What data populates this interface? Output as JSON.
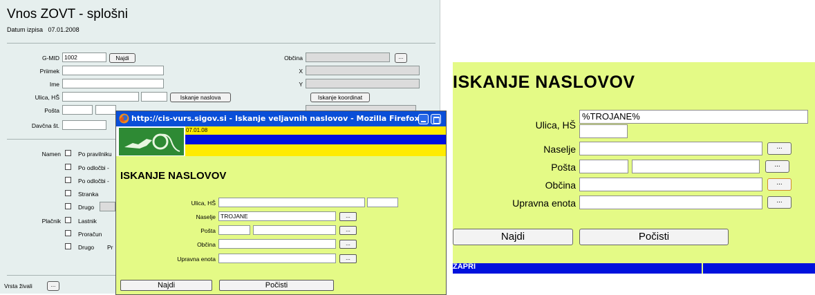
{
  "form": {
    "title": "Vnos ZOVT - splošni",
    "date_label": "Datum izpisa",
    "date_value": "07.01.2008",
    "gmid_label": "G-MID",
    "gmid_value": "1002",
    "najdi_label": "Najdi",
    "priimek_label": "Priimek",
    "ime_label": "Ime",
    "ulica_label": "Ulica, HŠ",
    "iskanje_naslova_label": "Iskanje naslova",
    "posta_label": "Pošta",
    "davcna_label": "Davčna št.",
    "obcina_label": "Občina",
    "x_label": "X",
    "y_label": "Y",
    "iskanje_koordinat_label": "Iskanje koordinat",
    "ellipsis": "...",
    "namen_label": "Namen",
    "namen_options": [
      "Po pravilniku",
      "Po odločbi -",
      "Po odločbi -",
      "Stranka",
      "Drugo"
    ],
    "placnik_label": "Plačnik",
    "placnik_options": [
      "Lastnik",
      "Proračun",
      "Drugo"
    ],
    "placnik_partial": "Pr",
    "vrsta_zivali_label": "Vrsta živali"
  },
  "popup": {
    "window_title": "http://cis-vurs.sigov.si - Iskanje veljavnih naslovov - Mozilla Firefox",
    "date": "07.01.08",
    "heading": "ISKANJE NASLOVOV",
    "ulica_label": "Ulica, HŠ",
    "naselje_label": "Naselje",
    "naselje_value": "TROJANE",
    "posta_label": "Pošta",
    "obcina_label": "Občina",
    "upravna_label": "Upravna enota",
    "ellipsis": "...",
    "najdi_label": "Najdi",
    "pocisti_label": "Počisti"
  },
  "zoom": {
    "heading": "ISKANJE NASLOVOV",
    "ulica_label": "Ulica, HŠ",
    "ulica_value": "%TROJANE%",
    "naselje_label": "Naselje",
    "posta_label": "Pošta",
    "obcina_label": "Občina",
    "upravna_label": "Upravna enota",
    "ellipsis": "...",
    "najdi_label": "Najdi",
    "pocisti_label": "Počisti",
    "footer_text": "ZAPRI"
  },
  "colors": {
    "form_bg": "#e6efee",
    "popup_bg": "#e4fa86",
    "titlebar": "#0a4fd8",
    "band_yellow": "#ffeb00",
    "band_blue": "#0011dd",
    "logo_green": "#2e8a34"
  },
  "icons": {
    "firefox": "firefox-icon",
    "logo": "veterinary-logo"
  }
}
